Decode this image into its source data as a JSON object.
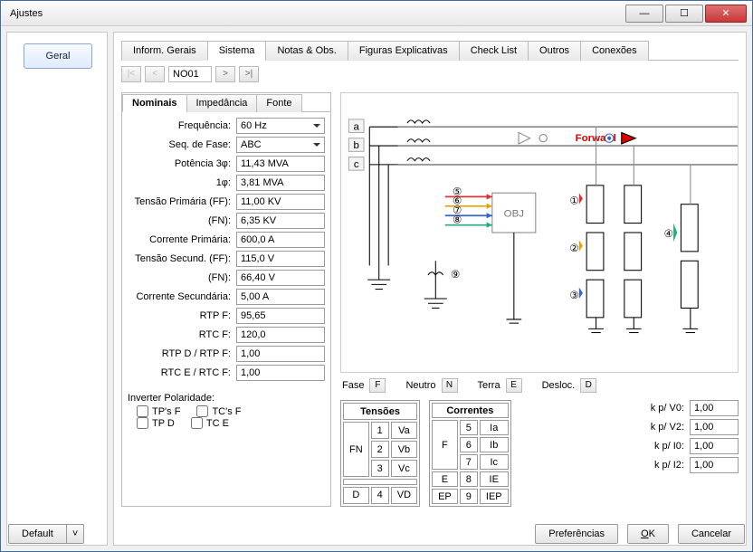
{
  "window": {
    "title": "Ajustes"
  },
  "left": {
    "geral": "Geral"
  },
  "tabs": {
    "items": [
      "Inform. Gerais",
      "Sistema",
      "Notas & Obs.",
      "Figuras Explicativas",
      "Check List",
      "Outros",
      "Conexões"
    ],
    "active": "Sistema"
  },
  "nav": {
    "first": "|<",
    "prev": "<",
    "combo": "NO01",
    "next": ">",
    "last": ">|"
  },
  "subtabs": {
    "items": [
      "Nominais",
      "Impedância",
      "Fonte"
    ],
    "active": "Nominais"
  },
  "form": {
    "frequencia_label": "Frequência:",
    "frequencia": "60 Hz",
    "seqfase_label": "Seq. de Fase:",
    "seqfase": "ABC",
    "pot3_label": "Potência 3φ:",
    "pot3": "11,43 MVA",
    "pot1_label": "1φ:",
    "pot1": "3,81 MVA",
    "tensprim_label": "Tensão Primária (FF):",
    "tensprim": "11,00 KV",
    "fn1_label": "(FN):",
    "fn1": "6,35 KV",
    "corrprim_label": "Corrente Primária:",
    "corrprim": "600,0 A",
    "tenssec_label": "Tensão Secund. (FF):",
    "tenssec": "115,0 V",
    "fn2_label": "(FN):",
    "fn2": "66,40 V",
    "corrsec_label": "Corrente Secundária:",
    "corrsec": "5,00 A",
    "rtpf_label": "RTP F:",
    "rtpf": "95,65",
    "rtcf_label": "RTC F:",
    "rtcf": "120,0",
    "rtpd_label": "RTP D / RTP F:",
    "rtpd": "1,00",
    "rtce_label": "RTC E / RTC F:",
    "rtce": "1,00"
  },
  "polarity": {
    "label": "Inverter Polaridade:",
    "tpsf": "TP's F",
    "tcsf": "TC's F",
    "tpd": "TP D",
    "tce": "TC E"
  },
  "diagram": {
    "a": "a",
    "b": "b",
    "c": "c",
    "obj": "OBJ",
    "forward": "Forward",
    "nums": [
      "①",
      "②",
      "③",
      "④",
      "⑤",
      "⑥",
      "⑦",
      "⑧",
      "⑨"
    ]
  },
  "legend": {
    "fase": "Fase",
    "fase_k": "F",
    "neutro": "Neutro",
    "neutro_k": "N",
    "terra": "Terra",
    "terra_k": "E",
    "desloc": "Desloc.",
    "desloc_k": "D"
  },
  "tensoes": {
    "title": "Tensões",
    "rows": [
      {
        "g": "FN",
        "n": "1",
        "v": "Va"
      },
      {
        "g": "",
        "n": "2",
        "v": "Vb"
      },
      {
        "g": "",
        "n": "3",
        "v": "Vc"
      },
      {
        "g": "D",
        "n": "4",
        "v": "VD"
      }
    ]
  },
  "correntes": {
    "title": "Correntes",
    "rows": [
      {
        "g": "F",
        "n": "5",
        "v": "Ia"
      },
      {
        "g": "",
        "n": "6",
        "v": "Ib"
      },
      {
        "g": "",
        "n": "7",
        "v": "Ic"
      },
      {
        "g": "E",
        "n": "8",
        "v": "IE"
      },
      {
        "g": "EP",
        "n": "9",
        "v": "IEP"
      }
    ]
  },
  "kp": {
    "v0_l": "k p/ V0:",
    "v0": "1,00",
    "v2_l": "k p/ V2:",
    "v2": "1,00",
    "i0_l": "k p/ I0:",
    "i0": "1,00",
    "i2_l": "k p/ I2:",
    "i2": "1,00"
  },
  "footer": {
    "default": "Default",
    "pref": "Preferências",
    "ok": "OK",
    "cancel": "Cancelar"
  }
}
